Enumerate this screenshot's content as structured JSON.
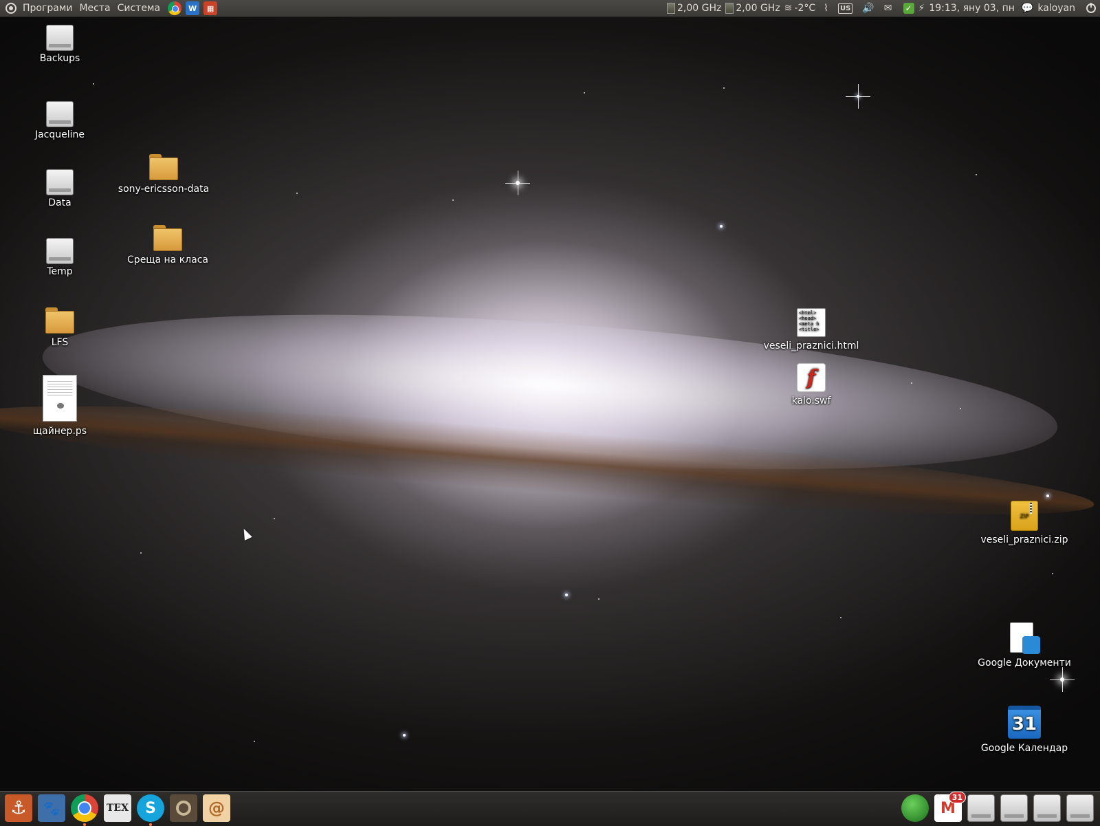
{
  "top_panel": {
    "menus": [
      "Програми",
      "Места",
      "Система"
    ],
    "launchers": [
      "chrome-icon",
      "writer-icon",
      "impress-icon"
    ],
    "cpu1": "2,00 GHz",
    "cpu2": "2,00 GHz",
    "weather": "-2°C",
    "keyboard": "US",
    "clock": "19:13, яну 03, пн",
    "user": "kaloyan"
  },
  "desktop_icons": {
    "backups": "Backups",
    "jacqueline": "Jacqueline",
    "data": "Data",
    "temp": "Temp",
    "lfs": "LFS",
    "ps_file": "щайнер.ps",
    "sony": "sony-ericsson-data",
    "sreshta": "Среща на класа",
    "html_file": "veseli_praznici.html",
    "html_preview": "<html>\n<head>\n<meta h\n<title>",
    "swf_file": "kalo.swf",
    "zip_file": "veseli_praznici.zip",
    "zip_tag": "ZIP",
    "gdocs": "Google Документи",
    "gcal": "Google Календар",
    "gcal_day": "31"
  },
  "dock": {
    "tex_label": "TEX",
    "gmail_badge": "31"
  },
  "colors": {
    "panel": "#3f3e3a",
    "panel_text": "#dfdbd2",
    "dock": "#262522"
  }
}
